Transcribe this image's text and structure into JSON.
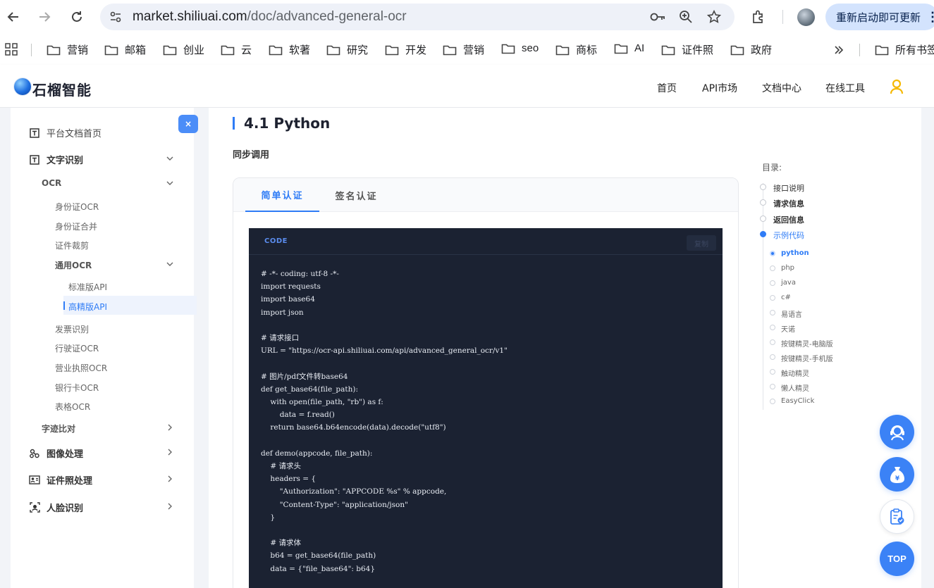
{
  "browser": {
    "url_host": "market.shiliuai.com",
    "url_path": "/doc/advanced-general-ocr",
    "update_label": "重新启动即可更新",
    "bookmarks": [
      "营销",
      "邮箱",
      "创业",
      "云",
      "软著",
      "研究",
      "开发",
      "营销",
      "seo",
      "商标",
      "AI",
      "证件照",
      "政府"
    ],
    "all_bookmarks_label": "所有书签"
  },
  "header": {
    "logo_text": "石榴智能",
    "nav": [
      "首页",
      "API市场",
      "文档中心",
      "在线工具"
    ]
  },
  "sidebar": {
    "close_label": "×",
    "home": "平台文档首页",
    "text_recognition": "文字识别",
    "ocr": "OCR",
    "id_card_ocr": "身份证OCR",
    "id_card_merge": "身份证合并",
    "id_crop": "证件裁剪",
    "general_ocr": "通用OCR",
    "standard_api": "标准版API",
    "advanced_api": "高精版API",
    "invoice": "发票识别",
    "driving_license": "行驶证OCR",
    "business_license": "营业执照OCR",
    "bank_card": "银行卡OCR",
    "table_ocr": "表格OCR",
    "handwriting_compare": "字迹比对",
    "image_processing": "图像处理",
    "id_photo": "证件照处理",
    "face_recognition": "人脸识别"
  },
  "content": {
    "section_title": "4.1 Python",
    "subtitle": "同步调用",
    "tabs": [
      "简单认证",
      "签名认证"
    ],
    "code_lang": "CODE",
    "copy_label": "复制",
    "code_lines": [
      "# -*- coding: utf-8 -*-",
      "import requests",
      "import base64",
      "import json",
      "",
      "# 请求接口",
      "URL = \"https://ocr-api.shiliuai.com/api/advanced_general_ocr/v1\"",
      "",
      "# 图片/pdf文件转base64",
      "def get_base64(file_path):",
      "    with open(file_path, \"rb\") as f:",
      "        data = f.read()",
      "    return base64.b64encode(data).decode(\"utf8\")",
      "",
      "def demo(appcode, file_path):",
      "    # 请求头",
      "    headers = {",
      "        \"Authorization\": \"APPCODE %s\" % appcode,",
      "        \"Content-Type\": \"application/json\"",
      "    }",
      "",
      "    # 请求体",
      "    b64 = get_base64(file_path)",
      "    data = {\"file_base64\": b64}"
    ]
  },
  "toc": {
    "title": "目录:",
    "items": [
      "接口说明",
      "请求信息",
      "返回信息",
      "示例代码"
    ],
    "sub_items": [
      "python",
      "php",
      "java",
      "c#",
      "易语言",
      "天诺",
      "按键精灵-电脑版",
      "按键精灵-手机版",
      "触动精灵",
      "懒人精灵",
      "EasyClick"
    ]
  },
  "floating": {
    "top_label": "TOP"
  },
  "colors": {
    "accent": "#2f7cf6",
    "code_bg": "#1b2232",
    "float_blue": "#3b82f6",
    "user_icon": "#f5b800"
  }
}
